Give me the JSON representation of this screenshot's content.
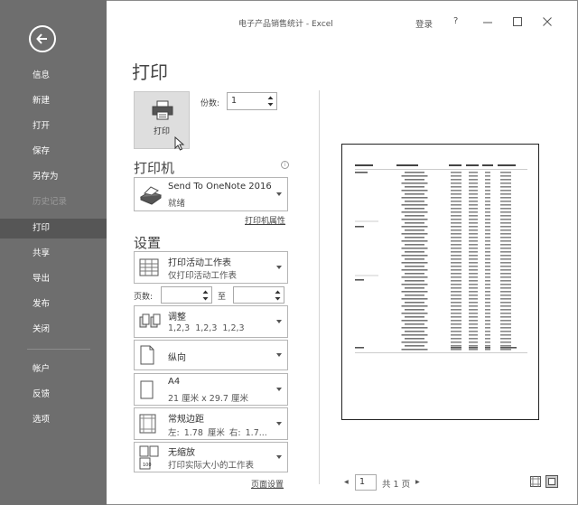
{
  "window": {
    "title": "电子产品销售统计 - Excel",
    "login": "登录",
    "help": "?"
  },
  "nav": {
    "items": [
      "信息",
      "新建",
      "打开",
      "保存",
      "另存为",
      "历史记录",
      "打印",
      "共享",
      "导出",
      "发布",
      "关闭",
      "帐户",
      "反馈",
      "选项"
    ],
    "active": "打印",
    "disabled": "历史记录"
  },
  "page_title": "打印",
  "print_button": {
    "label": "打印"
  },
  "copies": {
    "label": "份数:",
    "value": "1"
  },
  "printer": {
    "section_title": "打印机",
    "name": "Send To OneNote 2016",
    "status": "就绪",
    "properties_link": "打印机属性"
  },
  "settings": {
    "section_title": "设置",
    "print_what": {
      "main": "打印活动工作表",
      "sub": "仅打印活动工作表"
    },
    "pages": {
      "label": "页数:",
      "to": "至",
      "from_value": "",
      "to_value": ""
    },
    "collate": {
      "main": "调整",
      "sub": "1,2,3    1,2,3    1,2,3"
    },
    "orientation": {
      "main": "纵向"
    },
    "paper": {
      "main": "A4",
      "sub": "21 厘米 x 29.7 厘米"
    },
    "margins": {
      "main": "常规边距",
      "sub": "左: 1.78 厘米    右: 1.7..."
    },
    "scaling": {
      "main": "无缩放",
      "sub": "打印实际大小的工作表"
    },
    "page_setup_link": "页面设置"
  },
  "pager": {
    "current": "1",
    "total": "共 1 页"
  },
  "colors": {
    "nav_bg": "#6e6e6e",
    "nav_active": "#565656"
  }
}
